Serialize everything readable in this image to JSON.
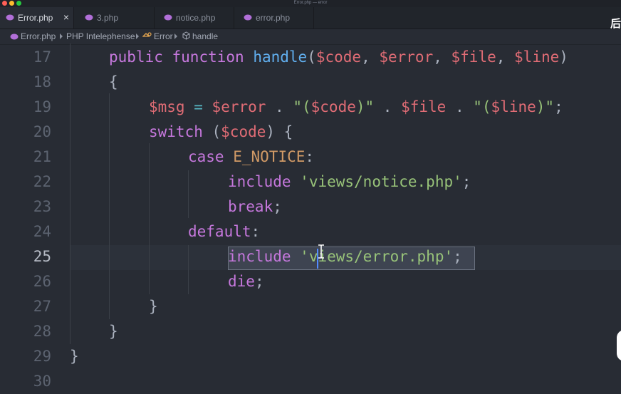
{
  "window": {
    "title": "Error.php — error"
  },
  "tabs": [
    {
      "label": "Error.php",
      "close": "×",
      "active": true
    },
    {
      "label": "3.php",
      "active": false
    },
    {
      "label": "notice.php",
      "active": false
    },
    {
      "label": "error.php",
      "active": false
    }
  ],
  "overlay_text": "后",
  "breadcrumb": {
    "file": "Error.php",
    "namespace": "PHP Intelephense",
    "class": "Error",
    "method": "handle"
  },
  "editor": {
    "current_line": 25,
    "lines": [
      {
        "num": "17",
        "code": [
          [
            "k",
            "public"
          ],
          [
            "p",
            " "
          ],
          [
            "k",
            "function"
          ],
          [
            "p",
            " "
          ],
          [
            "f",
            "handle"
          ],
          [
            "p",
            "("
          ],
          [
            "v",
            "$code"
          ],
          [
            "p",
            ", "
          ],
          [
            "v",
            "$error"
          ],
          [
            "p",
            ", "
          ],
          [
            "v",
            "$file"
          ],
          [
            "p",
            ", "
          ],
          [
            "v",
            "$line"
          ],
          [
            "p",
            ")"
          ]
        ]
      },
      {
        "num": "18",
        "code": [
          [
            "p",
            "{"
          ]
        ]
      },
      {
        "num": "19",
        "code": [
          [
            "v",
            "$msg"
          ],
          [
            "p",
            " "
          ],
          [
            "o",
            "="
          ],
          [
            "p",
            " "
          ],
          [
            "v",
            "$error"
          ],
          [
            "p",
            " . "
          ],
          [
            "s",
            "\"("
          ],
          [
            "v",
            "$code"
          ],
          [
            "s",
            ")\""
          ],
          [
            "p",
            " . "
          ],
          [
            "v",
            "$file"
          ],
          [
            "p",
            " . "
          ],
          [
            "s",
            "\"("
          ],
          [
            "v",
            "$line"
          ],
          [
            "s",
            ")\""
          ],
          [
            "p",
            ";"
          ]
        ]
      },
      {
        "num": "20",
        "code": [
          [
            "k",
            "switch"
          ],
          [
            "p",
            " ("
          ],
          [
            "v",
            "$code"
          ],
          [
            "p",
            ") {"
          ]
        ]
      },
      {
        "num": "21",
        "code": [
          [
            "k",
            "case"
          ],
          [
            "p",
            " "
          ],
          [
            "c",
            "E_NOTICE"
          ],
          [
            "p",
            ":"
          ]
        ]
      },
      {
        "num": "22",
        "code": [
          [
            "k",
            "include"
          ],
          [
            "p",
            " "
          ],
          [
            "s",
            "'views/notice.php'"
          ],
          [
            "p",
            ";"
          ]
        ]
      },
      {
        "num": "23",
        "code": [
          [
            "k",
            "break"
          ],
          [
            "p",
            ";"
          ]
        ]
      },
      {
        "num": "24",
        "code": [
          [
            "k",
            "default"
          ],
          [
            "p",
            ":"
          ]
        ]
      },
      {
        "num": "25",
        "code": [
          [
            "k",
            "include"
          ],
          [
            "p",
            " "
          ],
          [
            "s",
            "'views/error.php'"
          ],
          [
            "p",
            ";"
          ]
        ]
      },
      {
        "num": "26",
        "code": [
          [
            "k",
            "die"
          ],
          [
            "p",
            ";"
          ]
        ]
      },
      {
        "num": "27",
        "code": [
          [
            "p",
            "}"
          ]
        ]
      },
      {
        "num": "28",
        "code": [
          [
            "p",
            "}"
          ]
        ]
      },
      {
        "num": "29",
        "code": [
          [
            "p",
            "}"
          ]
        ]
      },
      {
        "num": "30",
        "code": []
      }
    ]
  },
  "colors": {
    "keyword": "#c678dd",
    "function": "#61afef",
    "variable": "#e06c75",
    "string": "#98c379",
    "constant": "#d19a66",
    "operator": "#56b6c2",
    "background": "#282c34"
  }
}
